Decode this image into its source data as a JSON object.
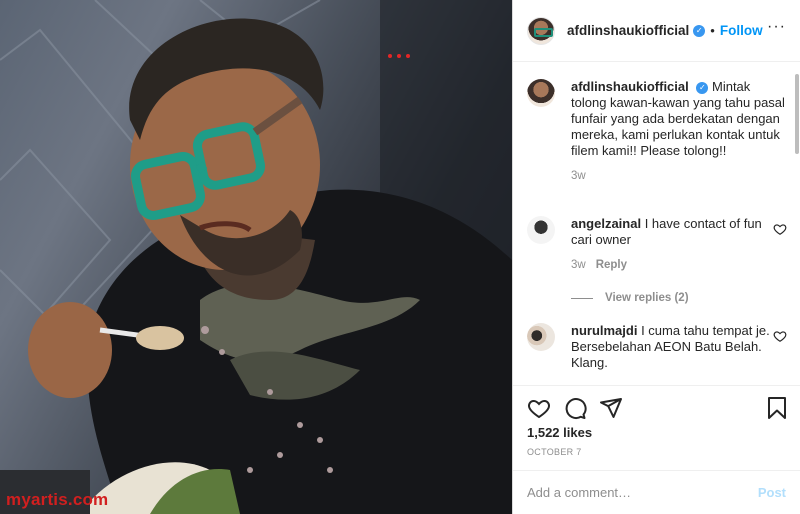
{
  "watermark": {
    "brand": "myartis",
    "tld": ".com"
  },
  "post": {
    "author": "afdlinshaukiofficial",
    "follow_label": "Follow",
    "separator": "•",
    "caption": "Mintak tolong kawan-kawan yang tahu pasal funfair yang ada berdekatan dengan mereka, kami perlukan kontak untuk filem kami!! Please tolong!!",
    "caption_time": "3w",
    "likes": "1,522 likes",
    "date": "OCTOBER 7"
  },
  "comments": [
    {
      "user": "angelzainal",
      "text": "I have contact of fun cari owner",
      "time": "3w",
      "reply_label": "Reply"
    },
    {
      "user": "nurulmajdi",
      "text": "I cuma tahu tempat je. Bersebelahan AEON Batu Belah. Klang."
    }
  ],
  "view_replies": "View replies (2)",
  "add_comment": {
    "placeholder": "Add a comment…",
    "post_label": "Post"
  },
  "icons": {
    "like": "heart-icon",
    "comment": "comment-icon",
    "share": "share-icon",
    "save": "bookmark-icon",
    "options": "more-icon",
    "verified": "verified-badge-icon"
  },
  "colors": {
    "link": "#0095f6",
    "verified": "#3897f0",
    "muted": "#8e8e8e",
    "post_disabled": "#b2dffc"
  }
}
